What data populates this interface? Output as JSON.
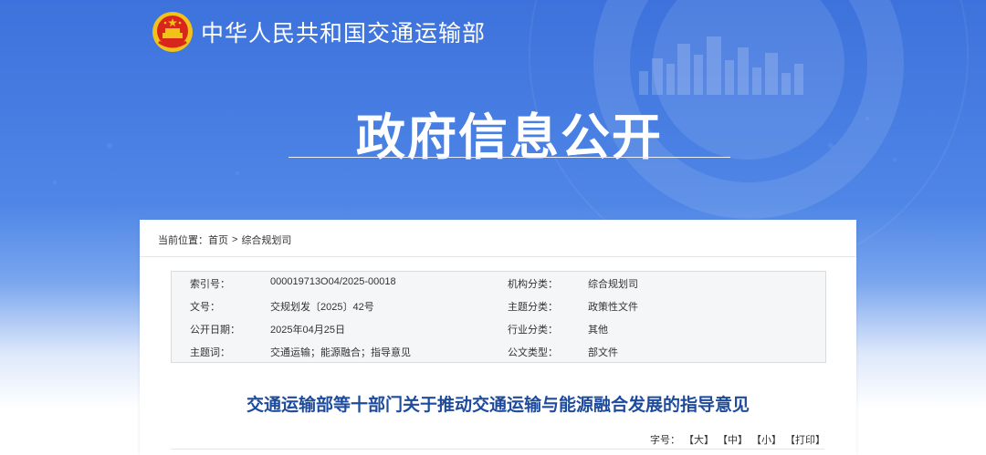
{
  "header": {
    "site_name": "中华人民共和国交通运输部",
    "hero_title": "政府信息公开"
  },
  "breadcrumb": {
    "prefix": "当前位置：",
    "home": "首页",
    "separator": ">",
    "current": "综合规划司"
  },
  "meta": {
    "rows": [
      {
        "k1": "索引号：",
        "v1": "000019713O04/2025-00018",
        "k2": "机构分类：",
        "v2": "综合规划司"
      },
      {
        "k1": "文号：",
        "v1": "交规划发〔2025〕42号",
        "k2": "主题分类：",
        "v2": "政策性文件"
      },
      {
        "k1": "公开日期：",
        "v1": "2025年04月25日",
        "k2": "行业分类：",
        "v2": "其他"
      },
      {
        "k1": "主题词：",
        "v1": "交通运输；能源融合；指导意见",
        "k2": "公文类型：",
        "v2": "部文件"
      }
    ]
  },
  "document": {
    "title": "交通运输部等十部门关于推动交通运输与能源融合发展的指导意见"
  },
  "font_controls": {
    "label": "字号：",
    "large": "【大】",
    "medium": "【中】",
    "small": "【小】",
    "print": "【打印】"
  },
  "colors": {
    "banner_blue": "#4f86e6",
    "title_blue": "#1e4b9c",
    "emblem_red": "#d8261c",
    "emblem_gold": "#f2c21b"
  }
}
